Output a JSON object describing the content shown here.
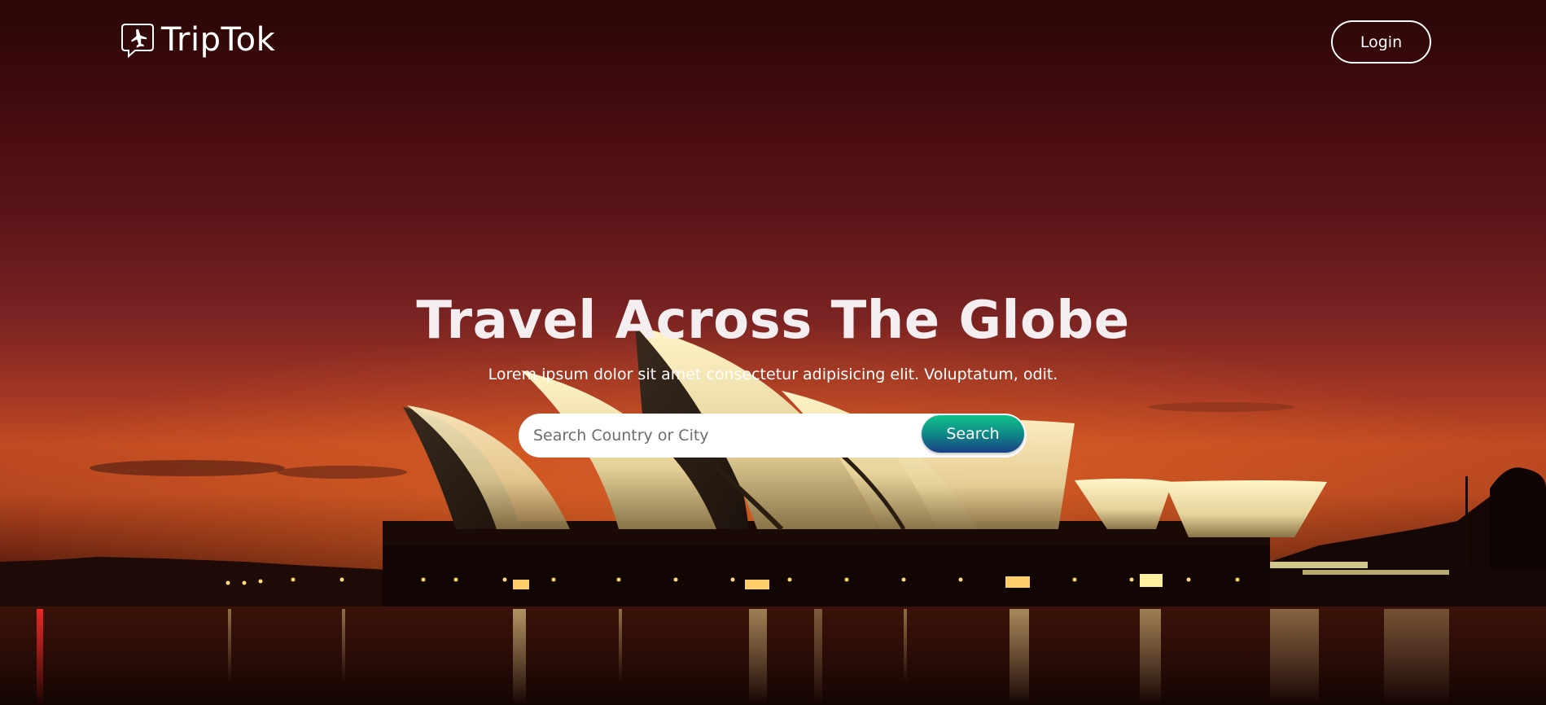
{
  "brand": {
    "name": "TripTok",
    "icon": "airplane-chat-icon"
  },
  "nav": {
    "login_label": "Login"
  },
  "hero": {
    "title": "Travel Across The Globe",
    "subtitle": "Lorem ipsum dolor sit amet consectetur adipisicing elit. Voluptatum, odit."
  },
  "search": {
    "placeholder": "Search Country or City",
    "value": "",
    "button_label": "Search"
  },
  "colors": {
    "text": "#ffffff",
    "search_button_top": "#12c28a",
    "search_button_bottom": "#1b3f86",
    "sky_top": "#2a0606",
    "sky_horizon": "#c04a22"
  }
}
